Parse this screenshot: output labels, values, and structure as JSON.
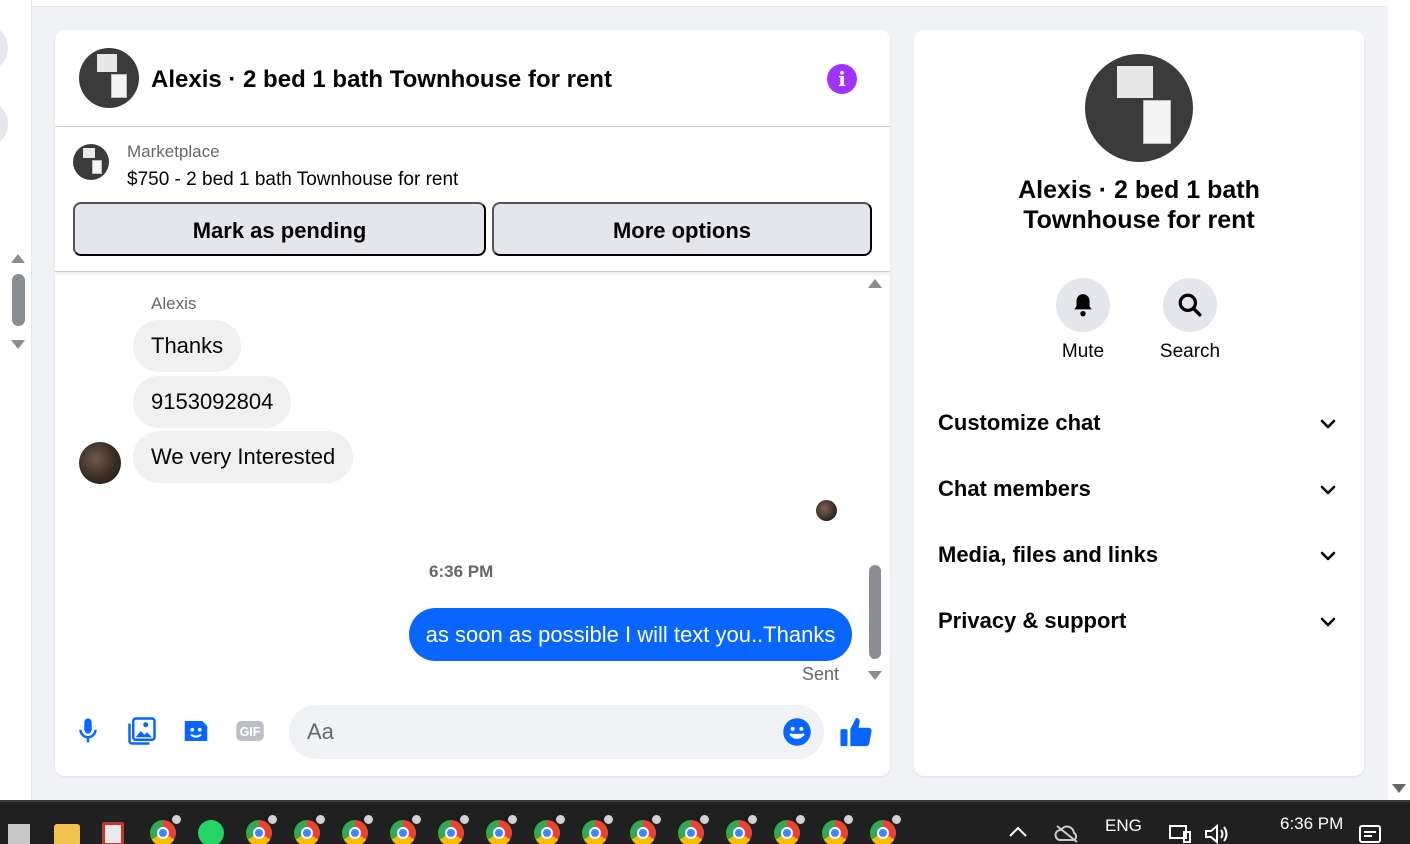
{
  "conversation": {
    "title": "Alexis · 2 bed 1 bath Townhouse for rent",
    "info_icon": "info-icon"
  },
  "marketplace": {
    "label": "Marketplace",
    "listing": "$750 - 2 bed 1 bath Townhouse for rent",
    "mark_pending_label": "Mark as pending",
    "more_options_label": "More options"
  },
  "messages": {
    "sender_name": "Alexis",
    "incoming": [
      "Thanks",
      "9153092804",
      "We very Interested"
    ],
    "timestamp": "6:36 PM",
    "outgoing": "as soon as possible I will text you..Thanks",
    "status": "Sent"
  },
  "composer": {
    "placeholder": "Aa",
    "icons": [
      "microphone-icon",
      "photo-icon",
      "sticker-icon",
      "gif-icon",
      "emoji-icon",
      "thumbs-up-icon"
    ]
  },
  "info_panel": {
    "title": "Alexis · 2 bed 1 bath Townhouse for rent",
    "actions": [
      {
        "label": "Mute",
        "icon": "bell-icon"
      },
      {
        "label": "Search",
        "icon": "search-icon"
      }
    ],
    "sections": [
      {
        "label": "Customize chat"
      },
      {
        "label": "Chat members"
      },
      {
        "label": "Media, files and links"
      },
      {
        "label": "Privacy & support"
      }
    ]
  },
  "taskbar": {
    "language": "ENG",
    "time": "6:36 PM"
  },
  "colors": {
    "accent": "#0866ff",
    "info_purple": "#a033ff",
    "bubble_grey": "#f0f0f0",
    "page_bg": "#f0f2f5"
  }
}
